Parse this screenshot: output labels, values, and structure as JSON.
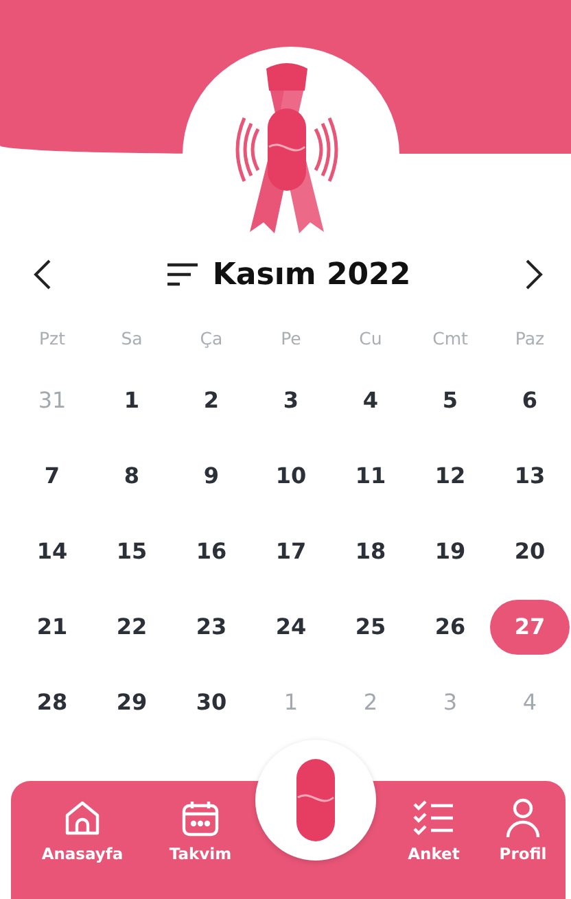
{
  "calendar": {
    "title": "Kasım 2022",
    "weekdays": [
      "Pzt",
      "Sa",
      "Ça",
      "Pe",
      "Cu",
      "Cmt",
      "Paz"
    ],
    "weeks": [
      [
        {
          "day": "31",
          "muted": true,
          "selected": false
        },
        {
          "day": "1",
          "muted": false,
          "selected": false
        },
        {
          "day": "2",
          "muted": false,
          "selected": false
        },
        {
          "day": "3",
          "muted": false,
          "selected": false
        },
        {
          "day": "4",
          "muted": false,
          "selected": false
        },
        {
          "day": "5",
          "muted": false,
          "selected": false
        },
        {
          "day": "6",
          "muted": false,
          "selected": false
        }
      ],
      [
        {
          "day": "7",
          "muted": false,
          "selected": false
        },
        {
          "day": "8",
          "muted": false,
          "selected": false
        },
        {
          "day": "9",
          "muted": false,
          "selected": false
        },
        {
          "day": "10",
          "muted": false,
          "selected": false
        },
        {
          "day": "11",
          "muted": false,
          "selected": false
        },
        {
          "day": "12",
          "muted": false,
          "selected": false
        },
        {
          "day": "13",
          "muted": false,
          "selected": false
        }
      ],
      [
        {
          "day": "14",
          "muted": false,
          "selected": false
        },
        {
          "day": "15",
          "muted": false,
          "selected": false
        },
        {
          "day": "16",
          "muted": false,
          "selected": false
        },
        {
          "day": "17",
          "muted": false,
          "selected": false
        },
        {
          "day": "18",
          "muted": false,
          "selected": false
        },
        {
          "day": "19",
          "muted": false,
          "selected": false
        },
        {
          "day": "20",
          "muted": false,
          "selected": false
        }
      ],
      [
        {
          "day": "21",
          "muted": false,
          "selected": false
        },
        {
          "day": "22",
          "muted": false,
          "selected": false
        },
        {
          "day": "23",
          "muted": false,
          "selected": false
        },
        {
          "day": "24",
          "muted": false,
          "selected": false
        },
        {
          "day": "25",
          "muted": false,
          "selected": false
        },
        {
          "day": "26",
          "muted": false,
          "selected": false
        },
        {
          "day": "27",
          "muted": false,
          "selected": true
        }
      ],
      [
        {
          "day": "28",
          "muted": false,
          "selected": false
        },
        {
          "day": "29",
          "muted": false,
          "selected": false
        },
        {
          "day": "30",
          "muted": false,
          "selected": false
        },
        {
          "day": "1",
          "muted": true,
          "selected": false
        },
        {
          "day": "2",
          "muted": true,
          "selected": false
        },
        {
          "day": "3",
          "muted": true,
          "selected": false
        },
        {
          "day": "4",
          "muted": true,
          "selected": false
        }
      ]
    ]
  },
  "nav": [
    {
      "kind": "home",
      "label": "Anasayfa"
    },
    {
      "kind": "calendar",
      "label": "Takvim"
    },
    {
      "kind": "center"
    },
    {
      "kind": "survey",
      "label": "Anket"
    },
    {
      "kind": "profile",
      "label": "Profil"
    }
  ]
}
